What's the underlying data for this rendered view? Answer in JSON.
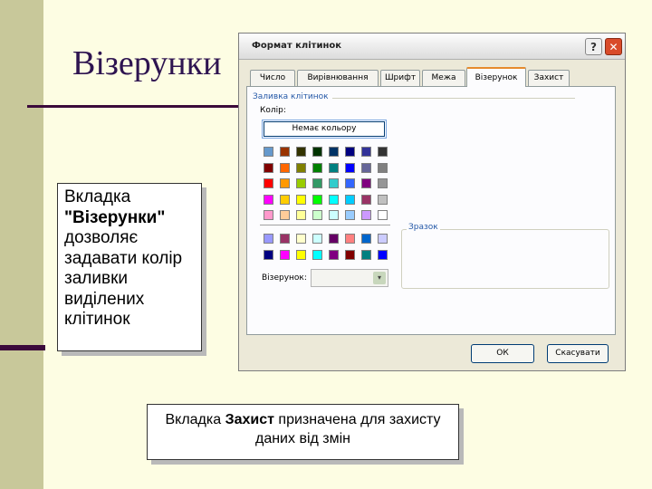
{
  "slide": {
    "title": "Візерунки",
    "note1_line1": "Вкладка",
    "note1_bold": "\"Візерунки\"",
    "note1_rest": "дозволяє задавати колір заливки виділених клітинок",
    "note2_prefix": "Вкладка ",
    "note2_bold": "Захист",
    "note2_suffix": " призначена для захисту даних від змін"
  },
  "dialog": {
    "title": "Формат клітинок",
    "help_label": "?",
    "close_label": "✕",
    "tabs": [
      "Число",
      "Вирівнювання",
      "Шрифт",
      "Межа",
      "Візерунок",
      "Захист"
    ],
    "active_tab": "Візерунок",
    "group_label": "Заливка клітинок",
    "color_label": "Колір:",
    "no_color_label": "Немає кольору",
    "sample_label": "Зразок",
    "pattern_label": "Візерунок:",
    "ok_label": "ОК",
    "cancel_label": "Скасувати"
  },
  "palette": {
    "main": [
      [
        "#6699cc",
        "#993300",
        "#333300",
        "#003300",
        "#003366",
        "#000080",
        "#333399",
        "#333333"
      ],
      [
        "#800000",
        "#ff6600",
        "#808000",
        "#008000",
        "#008080",
        "#0000ff",
        "#666699",
        "#808080"
      ],
      [
        "#ff0000",
        "#ff9900",
        "#99cc00",
        "#339966",
        "#33cccc",
        "#3366ff",
        "#800080",
        "#969696"
      ],
      [
        "#ff00ff",
        "#ffcc00",
        "#ffff00",
        "#00ff00",
        "#00ffff",
        "#00ccff",
        "#993366",
        "#c0c0c0"
      ],
      [
        "#ff99cc",
        "#ffcc99",
        "#ffff99",
        "#ccffcc",
        "#ccffff",
        "#99ccff",
        "#cc99ff",
        "#ffffff"
      ]
    ],
    "extra": [
      [
        "#9999ff",
        "#993366",
        "#ffffcc",
        "#ccffff",
        "#660066",
        "#ff8080",
        "#0066cc",
        "#ccccff"
      ],
      [
        "#000080",
        "#ff00ff",
        "#ffff00",
        "#00ffff",
        "#800080",
        "#800000",
        "#008080",
        "#0000ff"
      ]
    ]
  },
  "icons": {
    "dropdown": "▾"
  }
}
